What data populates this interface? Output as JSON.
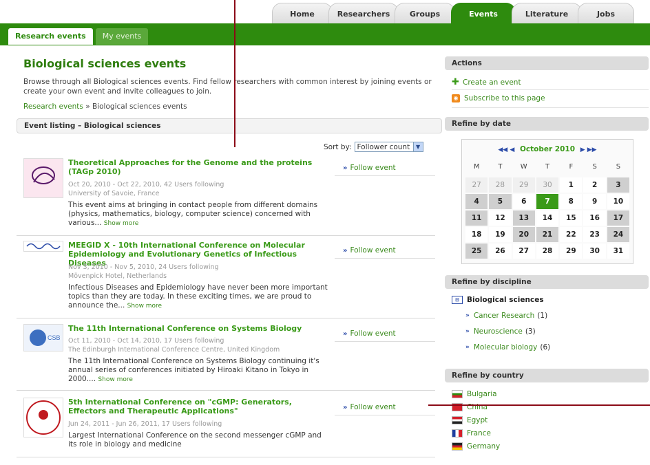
{
  "nav": {
    "top_tabs": [
      {
        "label": "Home",
        "active": false
      },
      {
        "label": "Researchers",
        "active": false
      },
      {
        "label": "Groups",
        "active": false
      },
      {
        "label": "Events",
        "active": true
      },
      {
        "label": "Literature",
        "active": false
      },
      {
        "label": "Jobs",
        "active": false
      }
    ],
    "sub_tabs": [
      {
        "label": "Research events",
        "active": true
      },
      {
        "label": "My events",
        "active": false
      }
    ]
  },
  "main": {
    "title": "Biological sciences events",
    "intro": "Browse through all Biological sciences events. Find fellow researchers with common interest by joining events or create your own event and invite colleagues to join.",
    "breadcrumb": {
      "root": "Research events",
      "separator": "»",
      "current": "Biological sciences events"
    },
    "listing_title": "Event listing – Biological sciences",
    "sort_label": "Sort by:",
    "sort_value": "Follower count",
    "follow_label": "Follow event",
    "events": [
      {
        "title": "Theoretical Approaches for the Genome and the proteins (TAGp 2010)",
        "meta": "Oct 20, 2010 - Oct 22, 2010, 42 Users following",
        "location": "University of Savoie, France",
        "desc": "This event aims at bringing in contact people from different domains (physics, mathematics, biology, computer science) concerned with various...",
        "more": "Show more"
      },
      {
        "title": "MEEGID X - 10th International Conference on Molecular Epidemiology and Evolutionary Genetics of Infectious Diseases",
        "meta": "Nov 3, 2010 - Nov 5, 2010, 24 Users following",
        "location": "Mövenpick Hotel, Netherlands",
        "desc": "Infectious Diseases and Epidemiology have never been more important topics than they are today. In these exciting times, we are proud to announce the...",
        "more": "Show more"
      },
      {
        "title": "The 11th International Conference on Systems Biology",
        "meta": "Oct 11, 2010 - Oct 14, 2010, 17 Users following",
        "location": "The Edinburgh International Conference Centre, United Kingdom",
        "desc": "The 11th International Conference on Systems Biology continuing it's annual series of conferences initiated by Hiroaki Kitano in Tokyo in 2000....",
        "more": "Show more"
      },
      {
        "title": "5th International Conference on \"cGMP: Generators, Effectors and Therapeutic Applications\"",
        "meta": "Jun 24, 2011 - Jun 26, 2011, 17 Users following",
        "location": "",
        "desc": "Largest International Conference on the second messenger cGMP and its role in biology and medicine",
        "more": ""
      }
    ]
  },
  "side": {
    "actions_title": "Actions",
    "actions": [
      "Create an event",
      "Subscribe to this page"
    ],
    "date_title": "Refine by date",
    "calendar": {
      "nav_prev": "◀◀ ◀",
      "month": "October 2010",
      "nav_next": "▶ ▶▶",
      "weekdays": [
        "M",
        "T",
        "W",
        "T",
        "F",
        "S",
        "S"
      ],
      "cells": [
        {
          "d": "27",
          "k": "other"
        },
        {
          "d": "28",
          "k": "other"
        },
        {
          "d": "29",
          "k": "other"
        },
        {
          "d": "30",
          "k": "other"
        },
        {
          "d": "1",
          "k": ""
        },
        {
          "d": "2",
          "k": ""
        },
        {
          "d": "3",
          "k": "hl"
        },
        {
          "d": "4",
          "k": "hl"
        },
        {
          "d": "5",
          "k": "hl"
        },
        {
          "d": "6",
          "k": ""
        },
        {
          "d": "7",
          "k": "today"
        },
        {
          "d": "8",
          "k": ""
        },
        {
          "d": "9",
          "k": ""
        },
        {
          "d": "10",
          "k": ""
        },
        {
          "d": "11",
          "k": "hl"
        },
        {
          "d": "12",
          "k": ""
        },
        {
          "d": "13",
          "k": "hl"
        },
        {
          "d": "14",
          "k": ""
        },
        {
          "d": "15",
          "k": ""
        },
        {
          "d": "16",
          "k": ""
        },
        {
          "d": "17",
          "k": "hl"
        },
        {
          "d": "18",
          "k": ""
        },
        {
          "d": "19",
          "k": ""
        },
        {
          "d": "20",
          "k": "hl"
        },
        {
          "d": "21",
          "k": "hl"
        },
        {
          "d": "22",
          "k": ""
        },
        {
          "d": "23",
          "k": ""
        },
        {
          "d": "24",
          "k": "hl"
        },
        {
          "d": "25",
          "k": "hl"
        },
        {
          "d": "26",
          "k": ""
        },
        {
          "d": "27",
          "k": ""
        },
        {
          "d": "28",
          "k": ""
        },
        {
          "d": "29",
          "k": ""
        },
        {
          "d": "30",
          "k": ""
        },
        {
          "d": "31",
          "k": ""
        }
      ]
    },
    "discipline_title": "Refine by discipline",
    "discipline_root": "Biological sciences",
    "disciplines": [
      {
        "label": "Cancer Research",
        "count": "(1)"
      },
      {
        "label": "Neuroscience",
        "count": "(3)"
      },
      {
        "label": "Molecular biology",
        "count": "(6)"
      }
    ],
    "country_title": "Refine by country",
    "countries": [
      {
        "label": "Bulgaria",
        "c1": "#ffffff",
        "c2": "#2e8b0e",
        "c3": "#d4202a"
      },
      {
        "label": "China",
        "c1": "#d4202a",
        "c2": "#d4202a",
        "c3": "#d4202a"
      },
      {
        "label": "Egypt",
        "c1": "#d4202a",
        "c2": "#ffffff",
        "c3": "#222222"
      },
      {
        "label": "France",
        "c1": "#1f3fa0",
        "c2": "#ffffff",
        "c3": "#d4202a"
      },
      {
        "label": "Germany",
        "c1": "#222222",
        "c2": "#d4202a",
        "c3": "#f2c500"
      }
    ]
  }
}
